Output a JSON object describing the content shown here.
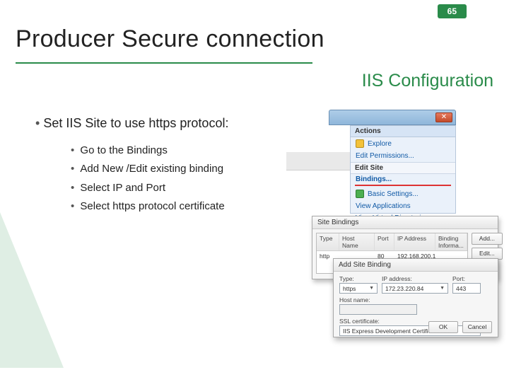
{
  "page_number": "65",
  "title": "Producer Secure connection",
  "subtitle": "IIS Configuration",
  "main_bullet": "Set IIS Site to use https protocol:",
  "sub_bullets": [
    "Go to the Bindings",
    "Add New /Edit existing binding",
    "Select IP and Port",
    "Select https protocol certificate"
  ],
  "actions_pane": {
    "header": "Actions",
    "explore": "Explore",
    "edit_perm": "Edit Permissions...",
    "edit_site": "Edit Site",
    "bindings": "Bindings...",
    "basic_settings": "Basic Settings...",
    "view_apps": "View Applications",
    "view_vdirs": "View Virtual Directories"
  },
  "site_bindings": {
    "title": "Site Bindings",
    "headers": {
      "type": "Type",
      "host": "Host Name",
      "port": "Port",
      "ip": "IP Address",
      "info": "Binding Informa..."
    },
    "row": {
      "type": "http",
      "host": "",
      "port": "80",
      "ip": "192.168.200.1"
    },
    "add_btn": "Add...",
    "edit_btn": "Edit..."
  },
  "add_site_binding": {
    "title": "Add Site Binding",
    "type_label": "Type:",
    "type_value": "https",
    "ip_label": "IP address:",
    "ip_value": "172.23.220.84",
    "port_label": "Port:",
    "port_value": "443",
    "host_label": "Host name:",
    "ssl_label": "SSL certificate:",
    "ssl_value": "IIS Express Development Certificate",
    "ok": "OK",
    "cancel": "Cancel"
  },
  "close_x": "✕"
}
